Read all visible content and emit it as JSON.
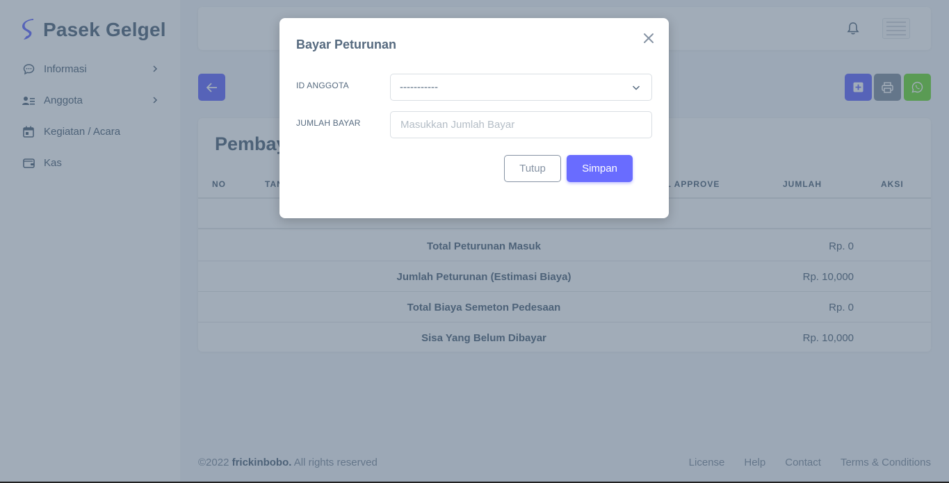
{
  "brand": {
    "name": "Pasek Gelgel",
    "icon": "brand-s-logo"
  },
  "sidebar": {
    "items": [
      {
        "label": "Informasi",
        "icon": "chat-bubble-icon",
        "has_submenu": true
      },
      {
        "label": "Anggota",
        "icon": "user-list-icon",
        "has_submenu": true
      },
      {
        "label": "Kegiatan / Acara",
        "icon": "calendar-icon",
        "has_submenu": false
      },
      {
        "label": "Kas",
        "icon": "wallet-icon",
        "has_submenu": false
      }
    ]
  },
  "navbar": {
    "notification_icon": "bell-icon",
    "avatar_icon": "avatar-image"
  },
  "actions": {
    "back_icon": "arrow-left-icon",
    "add_icon": "plus-square-icon",
    "print_icon": "printer-icon",
    "whatsapp_icon": "whatsapp-icon"
  },
  "card": {
    "title": "Pembay",
    "columns": [
      "NO",
      "TAN",
      "AL APPROVE",
      "JUMLAH",
      "AKSI"
    ],
    "summary": [
      {
        "label": "Total Peturunan Masuk",
        "value": "Rp. 0"
      },
      {
        "label": "Jumlah Peturunan (Estimasi Biaya)",
        "value": "Rp. 10,000"
      },
      {
        "label": "Total Biaya Semeton Pedesaan",
        "value": "Rp. 0"
      },
      {
        "label": "Sisa Yang Belum Dibayar",
        "value": "Rp. 10,000"
      }
    ]
  },
  "footer": {
    "copyright_prefix": "©2022 ",
    "copyright_name": "frickinbobo.",
    "copyright_suffix": " All rights reserved",
    "links": [
      "License",
      "Help",
      "Contact",
      "Terms & Conditions"
    ]
  },
  "modal": {
    "title": "Bayar Peturunan",
    "close_icon": "close-icon",
    "id_anggota_label": "ID ANGGOTA",
    "id_anggota_value": "-----------",
    "jumlah_bayar_label": "JUMLAH BAYAR",
    "jumlah_bayar_placeholder": "Masukkan Jumlah Bayar",
    "jumlah_bayar_value": "",
    "cancel_label": "Tutup",
    "save_label": "Simpan"
  },
  "colors": {
    "primary": "#696cff",
    "secondary": "#8592a3",
    "success": "#71dd37",
    "text": "#566a7f",
    "overlay": "rgba(67,89,113,0.5)"
  }
}
